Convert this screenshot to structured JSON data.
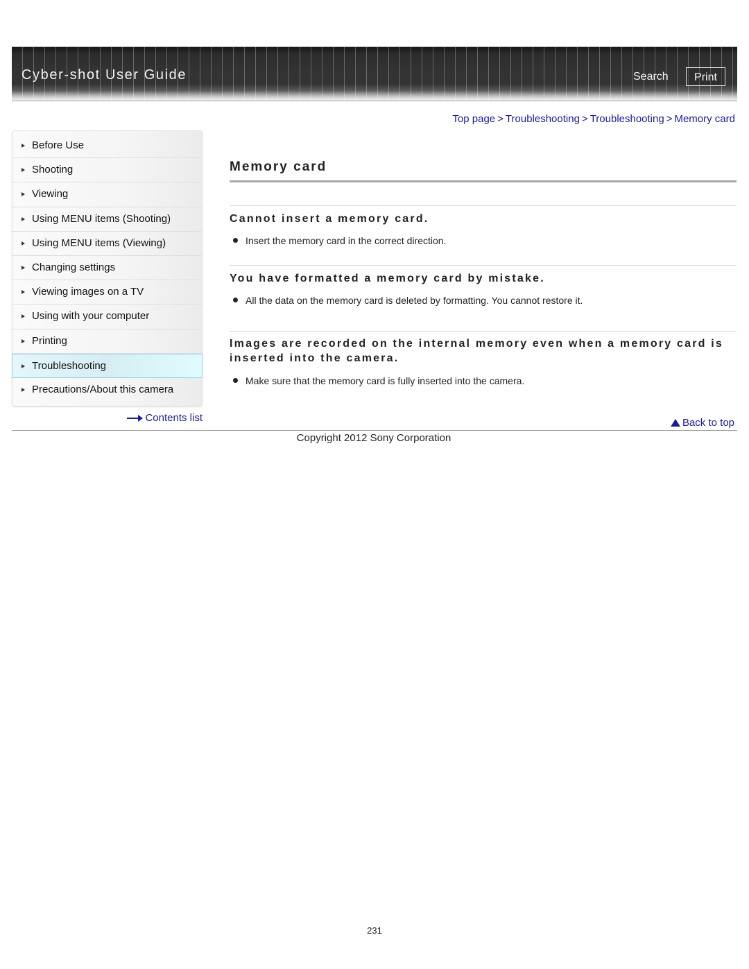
{
  "header": {
    "title": "Cyber-shot User Guide",
    "search_label": "Search",
    "print_label": "Print"
  },
  "breadcrumb": [
    {
      "label": "Top page"
    },
    {
      "label": "Troubleshooting"
    },
    {
      "label": "Troubleshooting"
    },
    {
      "label": "Memory card"
    }
  ],
  "breadcrumb_separator": ">",
  "sidebar": {
    "items": [
      {
        "label": "Before Use",
        "active": false
      },
      {
        "label": "Shooting",
        "active": false
      },
      {
        "label": "Viewing",
        "active": false
      },
      {
        "label": "Using MENU items (Shooting)",
        "active": false
      },
      {
        "label": "Using MENU items (Viewing)",
        "active": false
      },
      {
        "label": "Changing settings",
        "active": false
      },
      {
        "label": "Viewing images on a TV",
        "active": false
      },
      {
        "label": "Using with your computer",
        "active": false
      },
      {
        "label": "Printing",
        "active": false
      },
      {
        "label": "Troubleshooting",
        "active": true
      },
      {
        "label": "Precautions/About this camera",
        "active": false
      }
    ],
    "contents_link": "Contents list"
  },
  "main": {
    "title": "Memory card",
    "sections": [
      {
        "heading": "Cannot insert a memory card.",
        "bullets": [
          "Insert the memory card in the correct direction."
        ]
      },
      {
        "heading": "You have formatted a memory card by mistake.",
        "bullets": [
          "All the data on the memory card is deleted by formatting. You cannot restore it."
        ]
      },
      {
        "heading": "Images are recorded on the internal memory even when a memory card is inserted into the camera.",
        "bullets": [
          "Make sure that the memory card is fully inserted into the camera."
        ]
      }
    ],
    "back_to_top": "Back to top"
  },
  "footer": {
    "copyright": "Copyright 2012 Sony Corporation",
    "page_number": "231"
  },
  "colors": {
    "link": "#1a1aa6",
    "active_nav_border": "#8fd8ea",
    "header_bg": "#333333"
  }
}
